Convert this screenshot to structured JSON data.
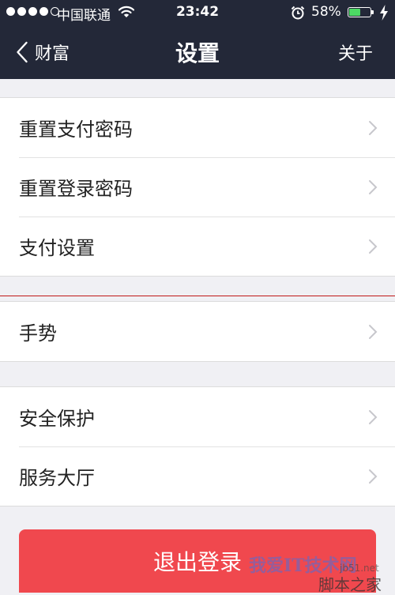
{
  "status_bar": {
    "carrier": "中国联通",
    "time": "23:42",
    "battery_percent": "58%",
    "battery_level": 0.58,
    "signal_bars": 4,
    "signal_total": 5
  },
  "nav": {
    "back_label": "财富",
    "title": "设置",
    "right_label": "关于"
  },
  "groups": [
    {
      "items": [
        {
          "label": "重置支付密码"
        },
        {
          "label": "重置登录密码"
        },
        {
          "label": "支付设置"
        }
      ]
    },
    {
      "items": [
        {
          "label": "手势"
        }
      ]
    },
    {
      "items": [
        {
          "label": "安全保护"
        },
        {
          "label": "服务大厅"
        }
      ]
    }
  ],
  "logout_label": "退出登录",
  "watermark": {
    "text_main": "我爱IT技术网",
    "text_url": "jb51.net",
    "text_brand": "脚本之家"
  },
  "colors": {
    "navbar_bg": "#232838",
    "page_bg": "#f0f0f4",
    "logout_bg": "#f0484e",
    "battery_fill": "#4cd964"
  },
  "icons": [
    "back-chevron-icon",
    "chevron-right-icon",
    "wifi-icon",
    "alarm-clock-icon",
    "battery-icon",
    "charging-bolt-icon"
  ]
}
